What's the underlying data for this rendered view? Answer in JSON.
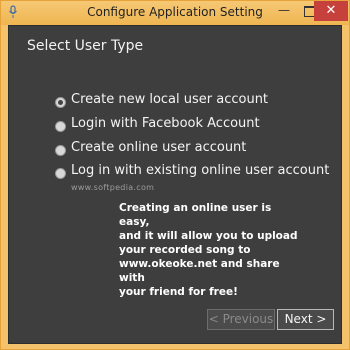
{
  "window": {
    "title": "Configure Application Setting",
    "minimize_glyph": "—",
    "close_glyph": "✕"
  },
  "page": {
    "section_title": "Select User Type",
    "options": [
      {
        "label": "Create new local user account",
        "selected": true
      },
      {
        "label": "Login with Facebook Account",
        "selected": false
      },
      {
        "label": "Create online user account",
        "selected": false
      },
      {
        "label": "Log in with existing online user account",
        "selected": false
      }
    ],
    "watermark": "www.softpedia.com",
    "info_lines": [
      "Creating an online user is easy,",
      "and it will allow you to upload",
      "your recorded song to",
      "www.okeoke.net and share with",
      "your friend for free!"
    ]
  },
  "buttons": {
    "previous": "< Previous",
    "next": "Next >"
  },
  "colors": {
    "frame_accent": "#f4c26b",
    "close_button": "#c7413c",
    "client_background": "#3e3e3e"
  },
  "icons": {
    "app": "microphone-icon"
  }
}
